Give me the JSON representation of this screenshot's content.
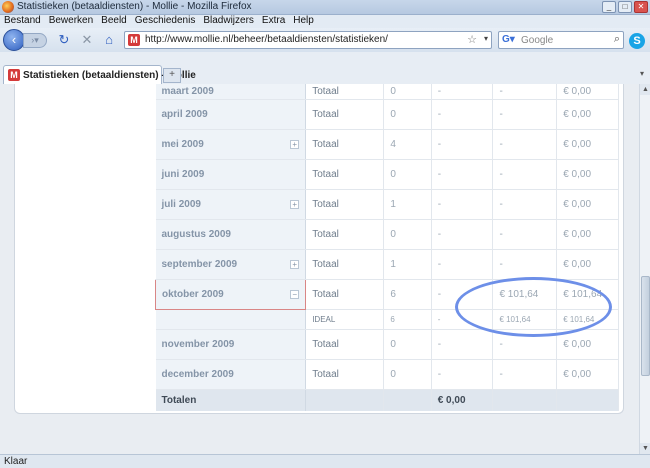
{
  "window": {
    "title": "Statistieken (betaaldiensten) - Mollie - Mozilla Firefox",
    "controls": [
      "_",
      "□",
      "✕"
    ]
  },
  "menu": [
    "Bestand",
    "Bewerken",
    "Beeld",
    "Geschiedenis",
    "Bladwijzers",
    "Extra",
    "Help"
  ],
  "nav": {
    "url": "http://www.mollie.nl/beheer/betaaldiensten/statistieken/",
    "search_placeholder": "Google",
    "site_icon": "M"
  },
  "tabs": [
    {
      "label": "Statistieken (betaaldiensten) - Mollie"
    }
  ],
  "rows": [
    {
      "month": "maart 2009",
      "type": "Totaal",
      "count": "0",
      "c4": "-",
      "c5": "-",
      "c6": "€ 0,00",
      "expand": false
    },
    {
      "month": "april 2009",
      "type": "Totaal",
      "count": "0",
      "c4": "-",
      "c5": "-",
      "c6": "€ 0,00",
      "expand": false
    },
    {
      "month": "mei 2009",
      "type": "Totaal",
      "count": "4",
      "c4": "-",
      "c5": "-",
      "c6": "€ 0,00",
      "expand": "+"
    },
    {
      "month": "juni 2009",
      "type": "Totaal",
      "count": "0",
      "c4": "-",
      "c5": "-",
      "c6": "€ 0,00",
      "expand": false
    },
    {
      "month": "juli 2009",
      "type": "Totaal",
      "count": "1",
      "c4": "-",
      "c5": "-",
      "c6": "€ 0,00",
      "expand": "+"
    },
    {
      "month": "augustus 2009",
      "type": "Totaal",
      "count": "0",
      "c4": "-",
      "c5": "-",
      "c6": "€ 0,00",
      "expand": false
    },
    {
      "month": "september 2009",
      "type": "Totaal",
      "count": "1",
      "c4": "-",
      "c5": "-",
      "c6": "€ 0,00",
      "expand": "+"
    },
    {
      "month": "oktober 2009",
      "type": "Totaal",
      "count": "6",
      "c4": "-",
      "c5": "€ 101,64",
      "c6": "€ 101,64",
      "expand": "−"
    },
    {
      "month": "",
      "type": "IDEAL",
      "count": "6",
      "c4": "-",
      "c5": "€ 101,64",
      "c6": "€ 101,64",
      "sub": true
    },
    {
      "month": "november 2009",
      "type": "Totaal",
      "count": "0",
      "c4": "-",
      "c5": "-",
      "c6": "€ 0,00",
      "expand": false
    },
    {
      "month": "december 2009",
      "type": "Totaal",
      "count": "0",
      "c4": "-",
      "c5": "-",
      "c6": "€ 0,00",
      "expand": false
    }
  ],
  "totals": {
    "label": "Totalen",
    "c4": "€ 0,00"
  },
  "status": "Klaar",
  "colors": {
    "accent": "#6d8fe8",
    "highlight_border": "#d98686"
  }
}
